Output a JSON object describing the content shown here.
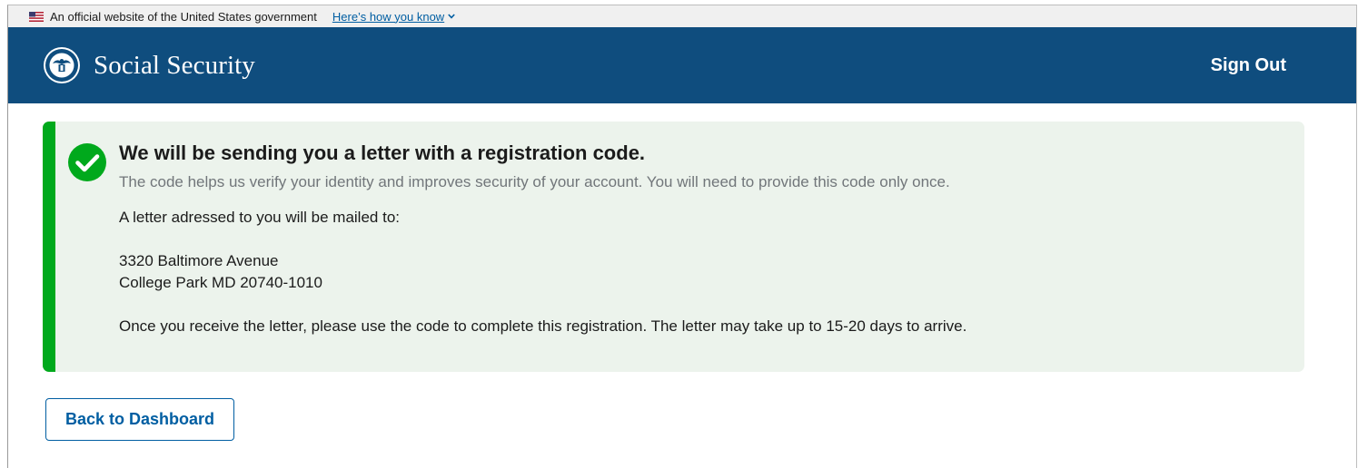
{
  "gov_banner": {
    "text": "An official website of the United States government",
    "link_label": "Here’s how you know",
    "icons": [
      "us-flag-icon",
      "chevron-down-icon"
    ]
  },
  "header": {
    "brand_name": "Social Security",
    "sign_out_label": "Sign Out",
    "background_color": "#0f4d7e",
    "icons": [
      "ssa-seal-icon"
    ]
  },
  "alert": {
    "status": "success",
    "accent_color": "#00a91c",
    "background_color": "#ecf3ec",
    "icon": "checkmark-circle-icon",
    "heading": "We will be sending you a letter with a registration code.",
    "subtext": "The code helps us verify your identity and improves security of your account. You will need to provide this code only once.",
    "mailed_intro": "A letter adressed to you will be mailed to:",
    "address_line1": "3320 Baltimore Avenue",
    "address_line2": "College Park MD 20740-1010",
    "closing": "Once you receive the letter, please use the code to complete this registration. The letter may take up to 15-20 days to arrive."
  },
  "actions": {
    "back_label": "Back to Dashboard",
    "accent_color": "#005ea2"
  }
}
